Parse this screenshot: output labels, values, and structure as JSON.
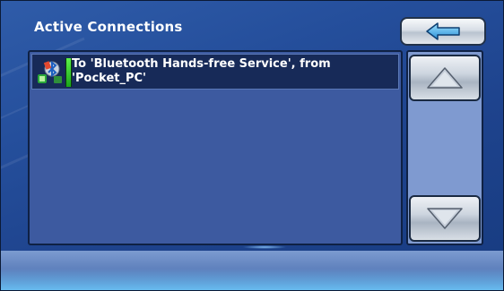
{
  "header": {
    "title": "Active Connections",
    "back_icon": "back-arrow-icon"
  },
  "connections": [
    {
      "line1": "To 'Bluetooth Hands-free Service', from",
      "line2": "'Pocket_PC'",
      "icon": "bluetooth-connection-icon",
      "status_color": "#4be33a"
    }
  ],
  "scrollbar": {
    "up_icon": "triangle-up-icon",
    "down_icon": "triangle-down-icon"
  },
  "colors": {
    "background": "#254f9c",
    "list_background": "#3d5aa0",
    "selected_item": "#172a58",
    "accent_glow": "#6ecdff"
  }
}
